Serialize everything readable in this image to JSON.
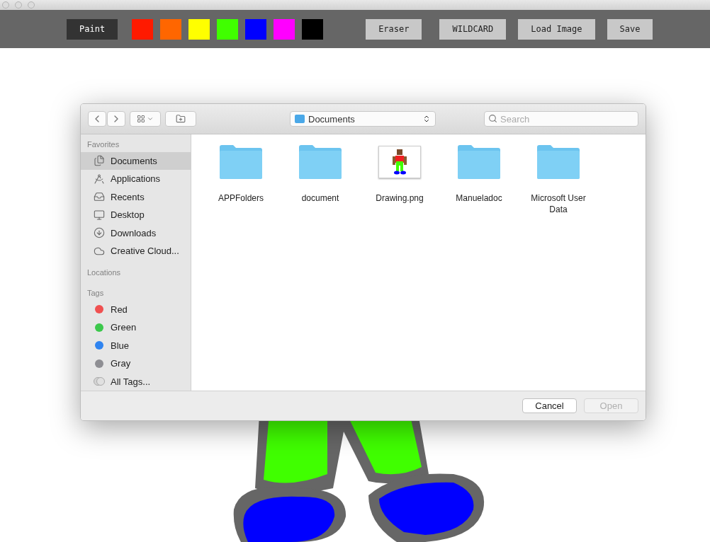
{
  "toolbar": {
    "tools": [
      {
        "label": "Paint",
        "selected": true
      }
    ],
    "palette": [
      {
        "color": "#ff1a00"
      },
      {
        "color": "#ff6600"
      },
      {
        "color": "#ffff00"
      },
      {
        "color": "#40ff00"
      },
      {
        "color": "#0000ff"
      },
      {
        "color": "#ff00ff"
      },
      {
        "color": "#000000"
      }
    ],
    "buttons": [
      {
        "label": "Eraser",
        "selected": false
      },
      {
        "label": "WILDCARD",
        "selected": false
      },
      {
        "label": "Load Image",
        "selected": false
      },
      {
        "label": "Save",
        "selected": false
      }
    ]
  },
  "dialog": {
    "location": "Documents",
    "search": {
      "placeholder": "Search"
    },
    "sidebar": {
      "favorites_heading": "Favorites",
      "favorites": [
        {
          "label": "Documents",
          "kind": "documents",
          "selected": true
        },
        {
          "label": "Applications",
          "kind": "applications",
          "selected": false
        },
        {
          "label": "Recents",
          "kind": "recents",
          "selected": false
        },
        {
          "label": "Desktop",
          "kind": "desktop",
          "selected": false
        },
        {
          "label": "Downloads",
          "kind": "downloads",
          "selected": false
        },
        {
          "label": "Creative Cloud...",
          "kind": "cloud",
          "selected": false
        }
      ],
      "locations_heading": "Locations",
      "tags_heading": "Tags",
      "tags": [
        {
          "label": "Red",
          "kind": "tag",
          "color": "#f05050"
        },
        {
          "label": "Green",
          "kind": "tag",
          "color": "#3cc84c"
        },
        {
          "label": "Blue",
          "kind": "tag",
          "color": "#2f84f0"
        },
        {
          "label": "Gray",
          "kind": "tag",
          "color": "#8e8e93"
        },
        {
          "label": "All Tags...",
          "kind": "all"
        }
      ]
    },
    "files": [
      {
        "name": "APPFolders",
        "kind": "folder"
      },
      {
        "name": "document",
        "kind": "folder"
      },
      {
        "name": "Drawing.png",
        "kind": "image"
      },
      {
        "name": "Manueladoc",
        "kind": "folder"
      },
      {
        "name": "Microsoft User Data",
        "kind": "folder"
      }
    ],
    "buttons": [
      {
        "label": "Cancel",
        "disabled": false
      },
      {
        "label": "Open",
        "disabled": true
      }
    ]
  }
}
